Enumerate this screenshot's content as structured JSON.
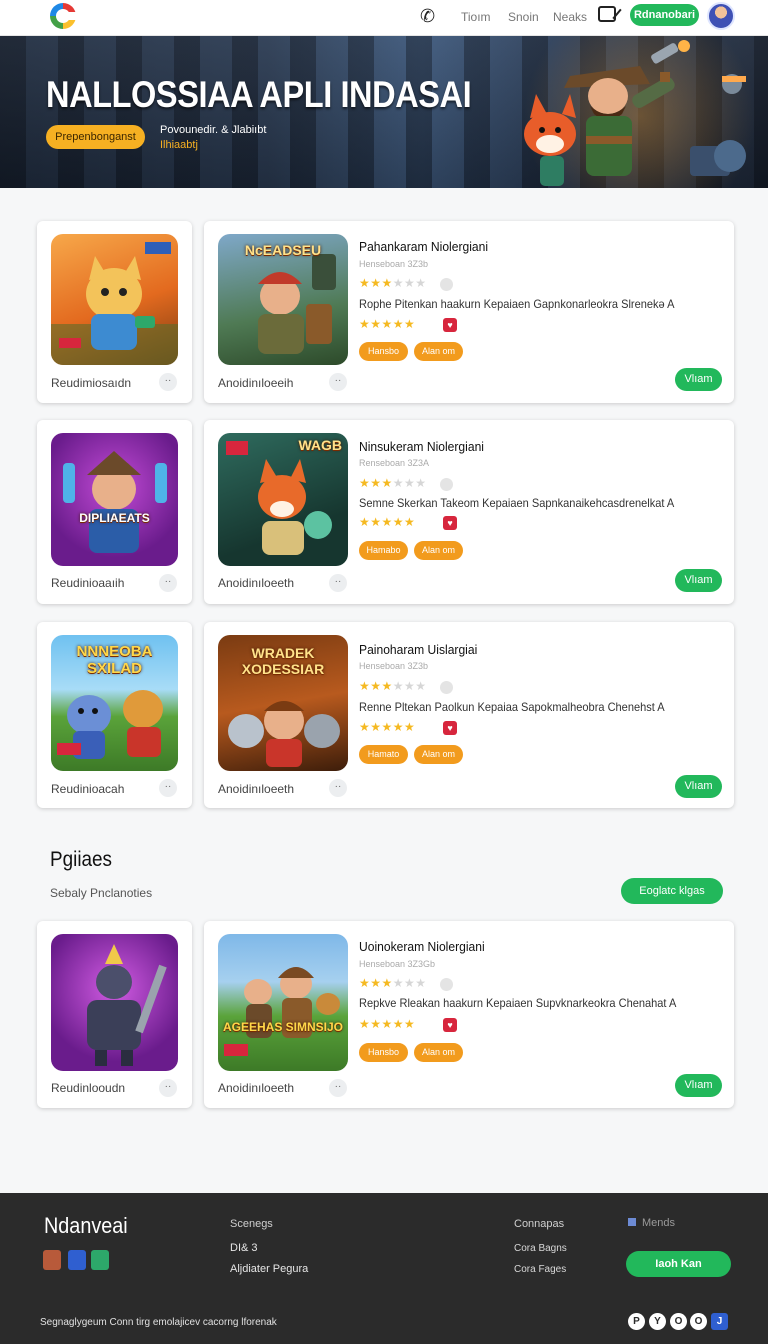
{
  "header": {
    "nav": [
      "Tioım",
      "Snoin",
      "Neaks"
    ],
    "signup_label": "Rdnanobari"
  },
  "hero": {
    "title": "NALLOSSIAA APLI INDASAI",
    "button_label": "Prepenbonganst",
    "sub_line1": "Povounedir. & Jlabiıbt",
    "sub_line2": "Ilhiaabtj"
  },
  "rows": [
    {
      "left": {
        "caption": "Reudimiosaıdn",
        "art_text": ""
      },
      "main": {
        "art_text": "NcEADSEU",
        "title": "Pahankaram Niolergiani",
        "meta": "Henseboan 3Z3b",
        "stars": 3,
        "description": "Rophe Pitenkan  haakurn Kepaiaen Gapnkonarleokra Slrenekə A",
        "rating_stars": 5,
        "tag1": "Hansbo",
        "tag2": "Alan om",
        "caption": "Anoidinıloeeih",
        "view_label": "Vlıam"
      }
    },
    {
      "left": {
        "caption": "Reudinioaaıih",
        "art_text": "DIPLIAEATS"
      },
      "main": {
        "art_text": "WAGB",
        "title": "Ninsukeram Niolergiani",
        "meta": "Renseboan 3Z3A",
        "stars": 3,
        "description": "Semne Skerkan Takeom Kepaiaen Sapnkanaikehcasdrenelkat A",
        "rating_stars": 5,
        "tag1": "Hamabo",
        "tag2": "Alan om",
        "caption": "Anoidinıloeeth",
        "view_label": "Vlıam"
      }
    },
    {
      "left": {
        "caption": "Reudinioacah",
        "art_text": "NNNEOBA SXILAD"
      },
      "main": {
        "art_text": "WRADEK XODESSIAR",
        "title": "Painoharam Uislargiai",
        "meta": "Henseboan 3Z3b",
        "stars": 3,
        "description": "Renne Pltekan  Paolkun Kepaiaa Sapokmalheobra Chenehst A",
        "rating_stars": 5,
        "tag1": "Hamato",
        "tag2": "Alan om",
        "caption": "Anoidinıloeeth",
        "view_label": "Vlıam"
      }
    },
    {
      "left": {
        "caption": "Reudinlooudn",
        "art_text": ""
      },
      "main": {
        "art_text": "AGEEHAS SIMNSIJO",
        "title": "Uoinokeram Niolergiani",
        "meta": "Henseboan 3Z3Gb",
        "stars": 3,
        "description": "Repkve Rleakan  haakurn Kepaiaen Supvknarkeokra Chenahat A",
        "rating_stars": 5,
        "tag1": "Hansbo",
        "tag2": "Alan om",
        "caption": "Anoidinıloeeth",
        "view_label": "Vlıam"
      }
    }
  ],
  "section": {
    "title": "Pgiiaes",
    "subtitle": "Sebaly Pnclanoties",
    "button_label": "Eoglatc klgas"
  },
  "footer": {
    "brand": "Ndanveai",
    "col2_title": "Scenegs",
    "col2_link1": "DI& 3",
    "col2_link2": "Aljdiater Pegura",
    "col3_title": "Connapas",
    "col3_link1": "Cora Bagns",
    "col3_link2": "Cora Fages",
    "col4_title": "Mends",
    "cta_label": "Iaoh Kan",
    "copyright": "Segnaglygeum Conn tirg  emolajicev cacorng lforenak",
    "social_glyphs": [
      "P",
      "Y",
      "O",
      "O",
      "J"
    ]
  },
  "colors": {
    "accent_green": "#22b85b",
    "accent_orange": "#f29b1d",
    "hero_button": "#f6b022",
    "star": "#f5b921",
    "footer_bg": "#2b2b2b"
  }
}
